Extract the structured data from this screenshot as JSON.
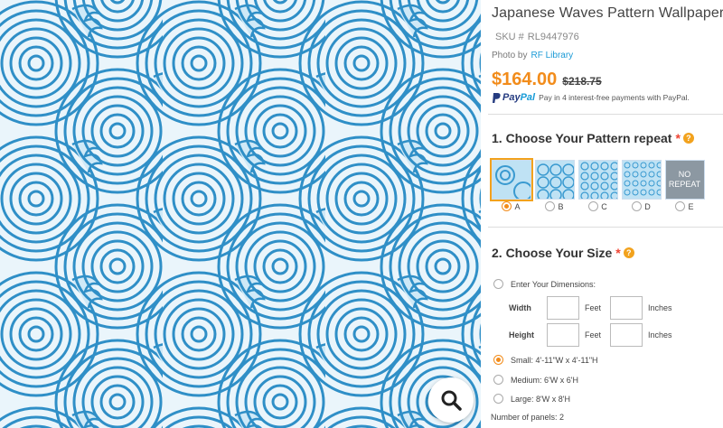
{
  "product": {
    "title": "Japanese Waves Pattern Wallpaper",
    "sku_label": "SKU #",
    "sku": "RL9447976",
    "photo_by_label": "Photo by",
    "photo_by": "RF Library",
    "price": "$164.00",
    "old_price": "$218.75",
    "paypal_pay": "Pay",
    "paypal_pal": "Pal",
    "paypal_text": "Pay in 4 interest-free payments with PayPal."
  },
  "colors": {
    "accent": "#f28c1b",
    "link": "#1b9ad6",
    "wave": "#2f8fc7",
    "wave_bg": "#eaf5fb"
  },
  "section1": {
    "title": "1. Choose Your Pattern repeat",
    "required": "*",
    "help": "?",
    "options": [
      {
        "label": "A",
        "selected": true
      },
      {
        "label": "B",
        "selected": false
      },
      {
        "label": "C",
        "selected": false
      },
      {
        "label": "D",
        "selected": false
      },
      {
        "label": "E",
        "selected": false,
        "thumb_text": "NO REPEAT"
      }
    ]
  },
  "section2": {
    "title": "2. Choose Your Size",
    "required": "*",
    "help": "?",
    "enter_dims": "Enter Your Dimensions:",
    "width_label": "Width",
    "height_label": "Height",
    "feet": "Feet",
    "inches": "Inches",
    "small": "Small: 4'-11\"W x 4'-11\"H",
    "medium": "Medium: 6'W x 6'H",
    "large": "Large: 8'W x 8'H",
    "selected": "small",
    "panels": "Number of panels: 2"
  },
  "icons": {
    "zoom": "magnifier-icon",
    "help": "question-icon",
    "paypal": "paypal-logo-icon"
  }
}
